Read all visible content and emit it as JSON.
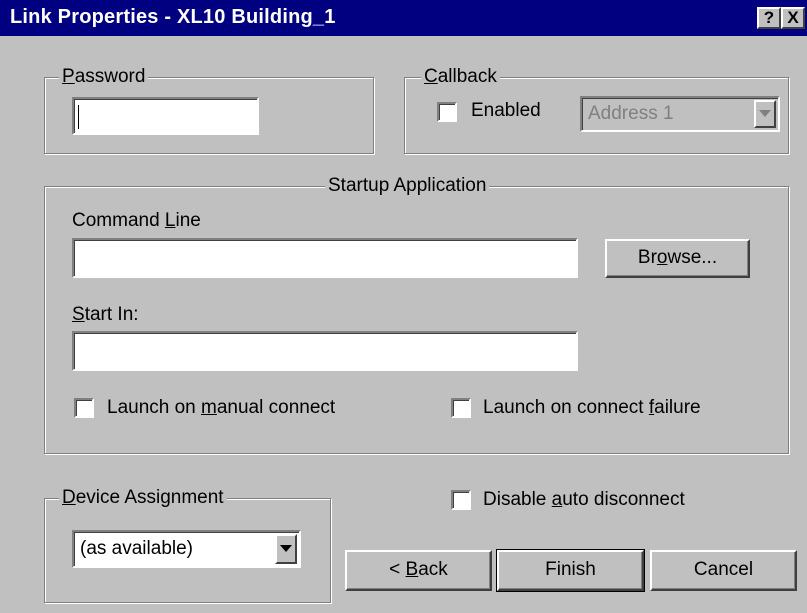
{
  "window": {
    "title": "Link Properties - XL10 Building_1",
    "help_label": "?",
    "close_label": "X"
  },
  "password": {
    "legend_pre": "",
    "legend_u": "P",
    "legend_post": "assword",
    "value": ""
  },
  "callback": {
    "legend_pre": "",
    "legend_u": "C",
    "legend_post": "allback",
    "enabled_label": "Enabled",
    "enabled_checked": false,
    "address_value": "Address 1"
  },
  "startup": {
    "legend": "Startup Application",
    "command_line_pre": "Command ",
    "command_line_u": "L",
    "command_line_post": "ine",
    "command_line_value": "",
    "browse_pre": "Br",
    "browse_u": "o",
    "browse_post": "wse...",
    "start_in_pre": "",
    "start_in_u": "S",
    "start_in_post": "tart In:",
    "start_in_value": "",
    "launch_manual_pre": "Launch on ",
    "launch_manual_u": "m",
    "launch_manual_post": "anual connect",
    "launch_manual_checked": false,
    "launch_failure_pre": "Launch on connect ",
    "launch_failure_u": "f",
    "launch_failure_post": "ailure",
    "launch_failure_checked": false
  },
  "device": {
    "legend_pre": "",
    "legend_u": "D",
    "legend_post": "evice Assignment",
    "value": "(as available)"
  },
  "disable_auto": {
    "pre": "Disable ",
    "u": "a",
    "post": "uto disconnect",
    "checked": false
  },
  "buttons": {
    "back_pre": "< ",
    "back_u": "B",
    "back_post": "ack",
    "finish": "Finish",
    "cancel": "Cancel"
  },
  "colors": {
    "titlebar": "#000080",
    "face": "#c0c0c0"
  }
}
